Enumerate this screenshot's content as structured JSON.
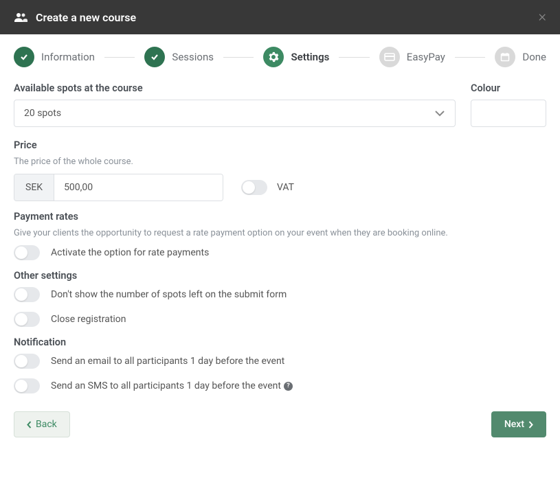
{
  "header": {
    "title": "Create a new course"
  },
  "stepper": {
    "s1": "Information",
    "s2": "Sessions",
    "s3": "Settings",
    "s4": "EasyPay",
    "s5": "Done"
  },
  "spots": {
    "label": "Available spots at the course",
    "value": "20 spots"
  },
  "colour": {
    "label": "Colour"
  },
  "price": {
    "label": "Price",
    "sub": "The price of the whole course.",
    "currency": "SEK",
    "value": "500,00",
    "vat": "VAT"
  },
  "rates": {
    "label": "Payment rates",
    "sub": "Give your clients the opportunity to request a rate payment option on your event when they are booking online.",
    "opt": "Activate the option for rate payments"
  },
  "other": {
    "label": "Other settings",
    "opt1": "Don't show the number of spots left on the submit form",
    "opt2": "Close registration"
  },
  "notif": {
    "label": "Notification",
    "opt1": "Send an email to all participants 1 day before the event",
    "opt2": "Send an SMS to all participants 1 day before the event"
  },
  "footer": {
    "back": "Back",
    "next": "Next"
  }
}
